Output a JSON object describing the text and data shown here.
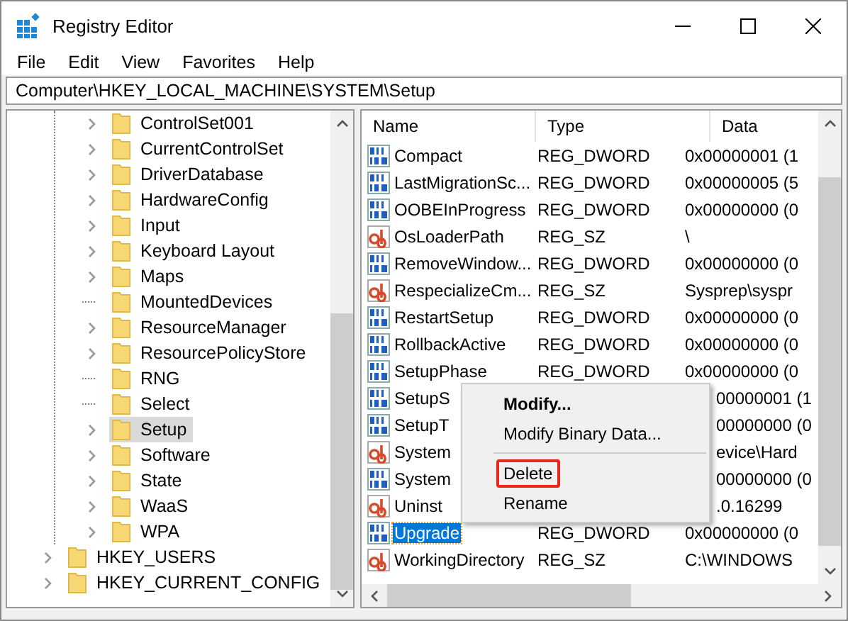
{
  "window": {
    "title": "Registry Editor"
  },
  "menu": [
    "File",
    "Edit",
    "View",
    "Favorites",
    "Help"
  ],
  "address": "Computer\\HKEY_LOCAL_MACHINE\\SYSTEM\\Setup",
  "tree": [
    {
      "expanded": true,
      "children": [
        {
          "label": "ControlSet001",
          "expandable": true,
          "selected": false
        },
        {
          "label": "CurrentControlSet",
          "expandable": true,
          "selected": false
        },
        {
          "label": "DriverDatabase",
          "expandable": true,
          "selected": false
        },
        {
          "label": "HardwareConfig",
          "expandable": true,
          "selected": false
        },
        {
          "label": "Input",
          "expandable": true,
          "selected": false
        },
        {
          "label": "Keyboard Layout",
          "expandable": true,
          "selected": false
        },
        {
          "label": "Maps",
          "expandable": true,
          "selected": false
        },
        {
          "label": "MountedDevices",
          "expandable": false,
          "selected": false
        },
        {
          "label": "ResourceManager",
          "expandable": true,
          "selected": false
        },
        {
          "label": "ResourcePolicyStore",
          "expandable": true,
          "selected": false
        },
        {
          "label": "RNG",
          "expandable": false,
          "selected": false
        },
        {
          "label": "Select",
          "expandable": false,
          "selected": false
        },
        {
          "label": "Setup",
          "expandable": true,
          "selected": true
        },
        {
          "label": "Software",
          "expandable": true,
          "selected": false
        },
        {
          "label": "State",
          "expandable": true,
          "selected": false
        },
        {
          "label": "WaaS",
          "expandable": true,
          "selected": false
        },
        {
          "label": "WPA",
          "expandable": true,
          "selected": false
        }
      ]
    },
    {
      "label": "HKEY_USERS",
      "expandable": true,
      "selected": false
    },
    {
      "label": "HKEY_CURRENT_CONFIG",
      "expandable": true,
      "selected": false
    }
  ],
  "columns": [
    "Name",
    "Type",
    "Data"
  ],
  "rows": [
    {
      "name": "Compact",
      "type": "REG_DWORD",
      "data": "0x00000001 (1",
      "kind": "dword",
      "selected": false
    },
    {
      "name": "LastMigrationSc...",
      "type": "REG_DWORD",
      "data": "0x00000005 (5",
      "kind": "dword",
      "selected": false
    },
    {
      "name": "OOBEInProgress",
      "type": "REG_DWORD",
      "data": "0x00000000 (0",
      "kind": "dword",
      "selected": false
    },
    {
      "name": "OsLoaderPath",
      "type": "REG_SZ",
      "data": "\\",
      "kind": "sz",
      "selected": false
    },
    {
      "name": "RemoveWindow...",
      "type": "REG_DWORD",
      "data": "0x00000000 (0",
      "kind": "dword",
      "selected": false
    },
    {
      "name": "RespecializeCm...",
      "type": "REG_SZ",
      "data": "Sysprep\\syspr",
      "kind": "sz",
      "selected": false
    },
    {
      "name": "RestartSetup",
      "type": "REG_DWORD",
      "data": "0x00000000 (0",
      "kind": "dword",
      "selected": false
    },
    {
      "name": "RollbackActive",
      "type": "REG_DWORD",
      "data": "0x00000000 (0",
      "kind": "dword",
      "selected": false
    },
    {
      "name": "SetupPhase",
      "type": "REG_DWORD",
      "data": "0x00000000 (0",
      "kind": "dword",
      "selected": false
    },
    {
      "name": "SetupS",
      "data": "00000001 (1",
      "kind": "dword",
      "selected": false
    },
    {
      "name": "SetupT",
      "data": "00000000 (0",
      "kind": "dword",
      "selected": false
    },
    {
      "name": "System",
      "data": "evice\\Hard",
      "kind": "sz",
      "selected": false
    },
    {
      "name": "System",
      "data": "00000000 (0",
      "kind": "dword",
      "selected": false
    },
    {
      "name": "Uninst",
      "data": ".0.16299",
      "kind": "sz",
      "selected": false
    },
    {
      "name": "Upgrade",
      "type": "REG_DWORD",
      "data": "0x00000000 (0",
      "kind": "dword",
      "selected": true
    },
    {
      "name": "WorkingDirectory",
      "type": "REG_SZ",
      "data": "C:\\WINDOWS",
      "kind": "sz",
      "selected": false
    }
  ],
  "context_menu": [
    {
      "label": "Modify...",
      "kind": "default",
      "highlighted": false
    },
    {
      "label": "Modify Binary Data...",
      "kind": "item",
      "highlighted": false
    },
    {
      "kind": "separator"
    },
    {
      "label": "Delete",
      "kind": "item",
      "highlighted": true
    },
    {
      "label": "Rename",
      "kind": "item",
      "highlighted": false
    }
  ]
}
